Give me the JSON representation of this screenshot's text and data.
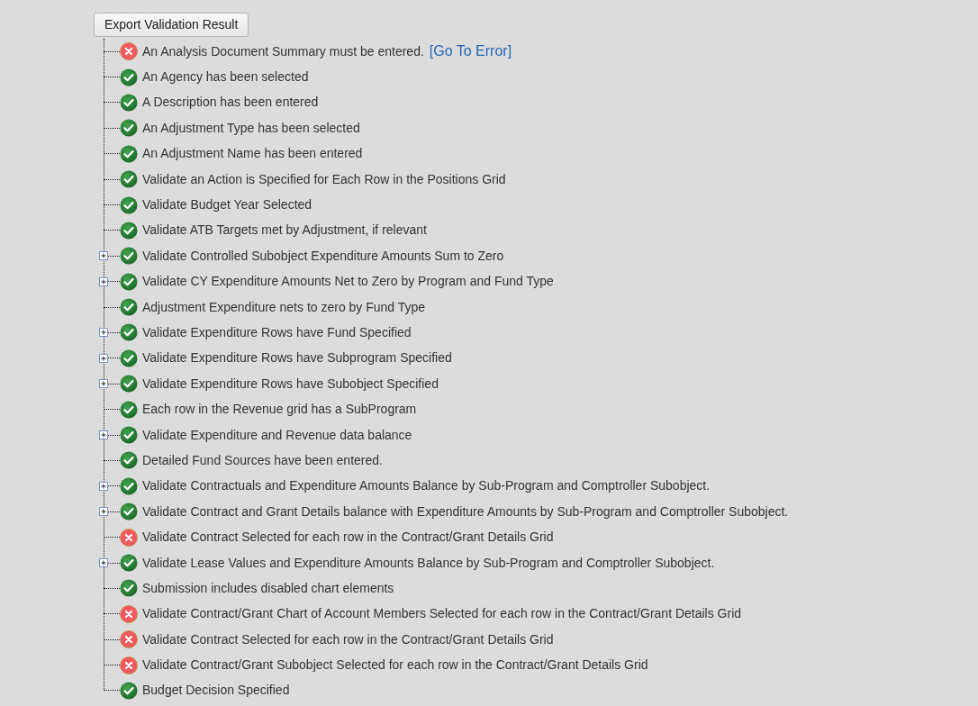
{
  "export_button": "Export Validation Result",
  "items": [
    {
      "passed": false,
      "text": "An Analysis Document Summary must be entered.",
      "expandable": false,
      "link": "[Go To Error]"
    },
    {
      "passed": true,
      "text": "An Agency has been selected",
      "expandable": false
    },
    {
      "passed": true,
      "text": "A Description has been entered",
      "expandable": false
    },
    {
      "passed": true,
      "text": "An Adjustment Type has been selected",
      "expandable": false
    },
    {
      "passed": true,
      "text": "An Adjustment Name has been entered",
      "expandable": false
    },
    {
      "passed": true,
      "text": "Validate an Action is Specified for Each Row in the Positions Grid",
      "expandable": false
    },
    {
      "passed": true,
      "text": "Validate Budget Year Selected",
      "expandable": false
    },
    {
      "passed": true,
      "text": "Validate ATB Targets met by Adjustment, if relevant",
      "expandable": false
    },
    {
      "passed": true,
      "text": "Validate Controlled Subobject Expenditure Amounts Sum to Zero",
      "expandable": true
    },
    {
      "passed": true,
      "text": "Validate CY Expenditure Amounts Net to Zero by Program and Fund Type",
      "expandable": true
    },
    {
      "passed": true,
      "text": "Adjustment Expenditure nets to zero by Fund Type",
      "expandable": false
    },
    {
      "passed": true,
      "text": "Validate Expenditure Rows have Fund Specified",
      "expandable": true
    },
    {
      "passed": true,
      "text": "Validate Expenditure Rows have Subprogram Specified",
      "expandable": true
    },
    {
      "passed": true,
      "text": "Validate Expenditure Rows have Subobject Specified",
      "expandable": true
    },
    {
      "passed": true,
      "text": "Each row in the Revenue grid has a SubProgram",
      "expandable": false
    },
    {
      "passed": true,
      "text": "Validate Expenditure and Revenue data balance",
      "expandable": true
    },
    {
      "passed": true,
      "text": "Detailed Fund Sources have been entered.",
      "expandable": false
    },
    {
      "passed": true,
      "text": "Validate Contractuals and Expenditure Amounts Balance by Sub-Program and Comptroller Subobject.",
      "expandable": true
    },
    {
      "passed": true,
      "text": "Validate Contract and Grant Details balance with Expenditure Amounts by Sub-Program and Comptroller Subobject.",
      "expandable": true
    },
    {
      "passed": false,
      "text": "Validate Contract Selected for each row in the Contract/Grant Details Grid",
      "expandable": false
    },
    {
      "passed": true,
      "text": "Validate Lease Values and Expenditure Amounts Balance by Sub-Program and Comptroller Subobject.",
      "expandable": true
    },
    {
      "passed": true,
      "text": "Submission includes disabled chart elements",
      "expandable": false
    },
    {
      "passed": false,
      "text": "Validate Contract/Grant Chart of Account Members Selected for each row in the Contract/Grant Details Grid",
      "expandable": false
    },
    {
      "passed": false,
      "text": "Validate Contract Selected for each row in the Contract/Grant Details Grid",
      "expandable": false
    },
    {
      "passed": false,
      "text": "Validate Contract/Grant Subobject Selected for each row in the Contract/Grant Details Grid",
      "expandable": false
    },
    {
      "passed": true,
      "text": "Budget Decision Specified",
      "expandable": false
    }
  ]
}
